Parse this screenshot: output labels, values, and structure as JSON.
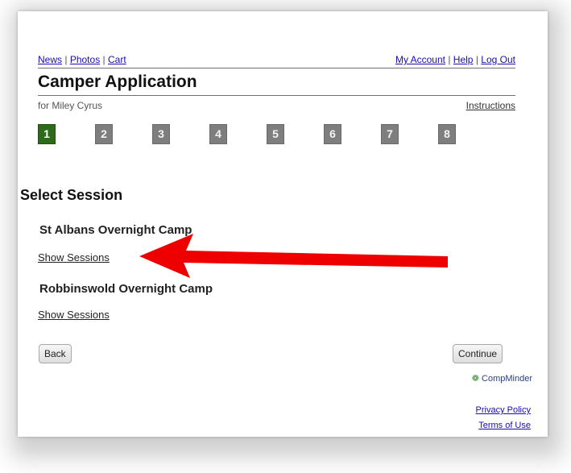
{
  "top_nav": {
    "left": [
      "News",
      "Photos",
      "Cart"
    ],
    "right": [
      "My Account",
      "Help",
      "Log Out"
    ],
    "separator": "|"
  },
  "page_title": "Camper Application",
  "subtitle": "for Miley Cyrus",
  "instructions_link": "Instructions",
  "steps": [
    "1",
    "2",
    "3",
    "4",
    "5",
    "6",
    "7",
    "8"
  ],
  "active_step": "1",
  "section_title": "Select Session",
  "camps": [
    {
      "name": "St Albans Overnight Camp",
      "link": "Show Sessions"
    },
    {
      "name": "Robbinswold Overnight Camp",
      "link": "Show Sessions"
    }
  ],
  "buttons": {
    "back": "Back",
    "continue": "Continue"
  },
  "footer": {
    "brand": "CompMinder",
    "privacy": "Privacy Policy",
    "terms": "Terms of Use"
  },
  "colors": {
    "active_step": "#2d6a19",
    "inactive_step": "#7e7e7e",
    "annotation_arrow": "#ee0000",
    "link": "#1a0dab"
  },
  "annotation": {
    "arrow_icon": "red-arrow-icon",
    "points_to": "Show Sessions"
  }
}
